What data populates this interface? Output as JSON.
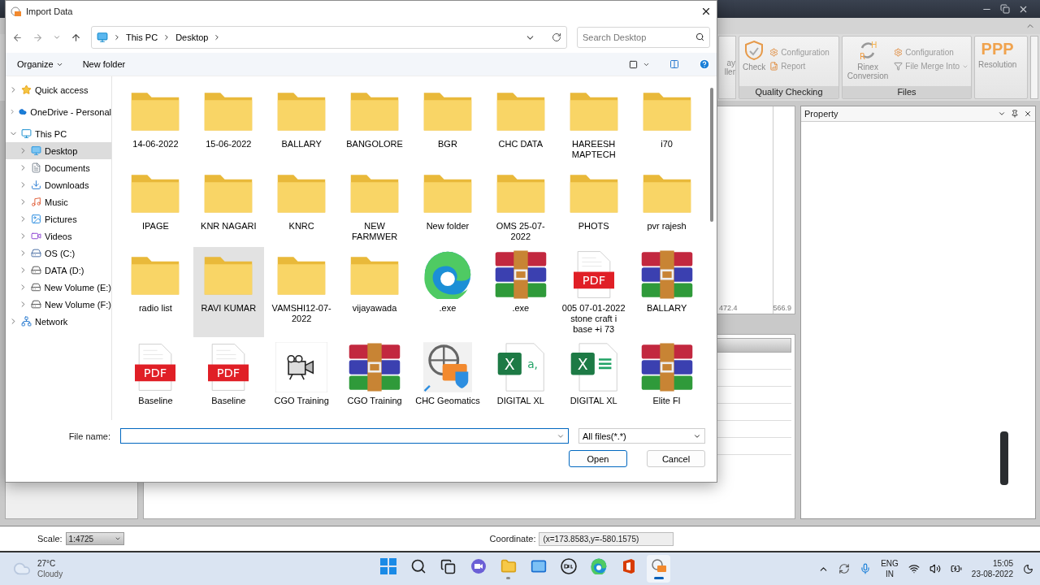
{
  "app": {
    "ribbon": {
      "partial_button": {
        "line_1": "ay",
        "line_2": "ller"
      },
      "groups": [
        {
          "label": "Quality Checking",
          "large": {
            "kind": "qc",
            "label": "Check"
          },
          "small": [
            {
              "kind": "config",
              "label": "Configuration",
              "dropdown": false
            },
            {
              "kind": "report",
              "label": "Report",
              "dropdown": false
            }
          ]
        },
        {
          "label": "Files",
          "large": {
            "kind": "rinex",
            "letters": [
              "R",
              "H"
            ],
            "label": "Rinex Conversion"
          },
          "small": [
            {
              "kind": "config",
              "label": "Configuration",
              "dropdown": false
            },
            {
              "kind": "merge",
              "label": "File Merge Into",
              "dropdown": true
            }
          ]
        },
        {
          "large": {
            "kind": "ppp",
            "glyph": "PPP",
            "label": "Resolution"
          }
        }
      ]
    },
    "plot": {
      "axis_labels": [
        "472.4",
        "566.9"
      ]
    },
    "property_panel": {
      "title": "Property"
    },
    "status_bar": {
      "scale_label": "Scale:",
      "scale_value": "1:4725",
      "coordinate_label": "Coordinate:",
      "coordinate_value": "(x=173.8583,y=-580.1575)"
    }
  },
  "dialog": {
    "title": "Import Data",
    "breadcrumb": [
      "This PC",
      "Desktop"
    ],
    "search_placeholder": "Search Desktop",
    "commands": [
      {
        "label": "Organize",
        "dropdown": true
      },
      {
        "label": "New folder",
        "dropdown": false
      }
    ],
    "sidebar": [
      {
        "kind": "star",
        "label": "Quick access",
        "expanded": false,
        "selected": false
      },
      {
        "kind": "cloud",
        "label": "OneDrive - Personal",
        "expanded": false,
        "selected": false
      },
      {
        "kind": "pc",
        "label": "This PC",
        "expanded": true,
        "selected": false,
        "children": [
          {
            "kind": "desktop",
            "label": "Desktop",
            "expanded": false,
            "selected": true
          },
          {
            "kind": "documents",
            "label": "Documents",
            "expanded": false,
            "selected": false
          },
          {
            "kind": "downloads",
            "label": "Downloads",
            "expanded": false,
            "selected": false
          },
          {
            "kind": "music",
            "label": "Music",
            "expanded": false,
            "selected": false
          },
          {
            "kind": "pictures",
            "label": "Pictures",
            "expanded": false,
            "selected": false
          },
          {
            "kind": "videos",
            "label": "Videos",
            "expanded": false,
            "selected": false
          },
          {
            "kind": "osdrive",
            "label": "OS (C:)",
            "expanded": false,
            "selected": false
          },
          {
            "kind": "drive",
            "label": "DATA (D:)",
            "expanded": false,
            "selected": false
          },
          {
            "kind": "drive",
            "label": "New Volume (E:)",
            "expanded": false,
            "selected": false
          },
          {
            "kind": "drive",
            "label": "New Volume (F:)",
            "expanded": false,
            "selected": false
          }
        ]
      },
      {
        "kind": "network",
        "label": "Network",
        "expanded": false,
        "selected": false
      }
    ],
    "files": [
      {
        "kind": "folder",
        "name": "14-06-2022",
        "selected": false
      },
      {
        "kind": "folder",
        "name": "15-06-2022",
        "selected": false
      },
      {
        "kind": "folder",
        "name": "BALLARY",
        "selected": false
      },
      {
        "kind": "folder",
        "name": "BANGOLORE",
        "selected": false
      },
      {
        "kind": "folder",
        "name": "BGR",
        "selected": false
      },
      {
        "kind": "folder",
        "name": "CHC DATA",
        "selected": false
      },
      {
        "kind": "folder",
        "name": "HAREESH MAPTECH",
        "selected": false
      },
      {
        "kind": "folder",
        "name": "i70",
        "selected": false
      },
      {
        "kind": "folder",
        "name": "IPAGE",
        "selected": false
      },
      {
        "kind": "folder",
        "name": "KNR NAGARI",
        "selected": false
      },
      {
        "kind": "folder",
        "name": "KNRC",
        "selected": false
      },
      {
        "kind": "folder",
        "name": "NEW FARMWER",
        "selected": false
      },
      {
        "kind": "folder",
        "name": "New folder",
        "selected": false
      },
      {
        "kind": "folder",
        "name": "OMS 25-07-2022",
        "selected": false
      },
      {
        "kind": "folder",
        "name": "PHOTS",
        "selected": false
      },
      {
        "kind": "folder",
        "name": "pvr rajesh",
        "selected": false
      },
      {
        "kind": "folder",
        "name": "radio list",
        "selected": false
      },
      {
        "kind": "folder",
        "name": "RAVI KUMAR",
        "selected": true
      },
      {
        "kind": "folder",
        "name": "VAMSHI12-07-2022",
        "selected": false
      },
      {
        "kind": "folder",
        "name": "vijayawada",
        "selected": false
      },
      {
        "kind": "browser",
        "name": ".exe",
        "selected": false
      },
      {
        "kind": "archive",
        "name": ".exe",
        "selected": false
      },
      {
        "kind": "pdf",
        "badge": "PDF",
        "name": "005 07-01-2022 stone craft i base +i 73",
        "selected": false
      },
      {
        "kind": "archive",
        "name": "BALLARY",
        "selected": false
      },
      {
        "kind": "pdf",
        "badge": "PDF",
        "name": "Baseline",
        "selected": false
      },
      {
        "kind": "pdf",
        "badge": "PDF",
        "name": "Baseline",
        "selected": false
      },
      {
        "kind": "camera",
        "name": "CGO Training",
        "selected": false
      },
      {
        "kind": "archive",
        "name": "CGO Training",
        "selected": false
      },
      {
        "kind": "globe",
        "name": "CHC Geomatics",
        "selected": false
      },
      {
        "kind": "csv",
        "badge": "X",
        "badge_2": "a,",
        "name": "DIGITAL XL",
        "selected": false
      },
      {
        "kind": "sheet",
        "badge": "X",
        "name": "DIGITAL XL",
        "selected": false
      },
      {
        "kind": "archive",
        "name": "Elite FI",
        "selected": false
      }
    ],
    "file_name": {
      "label": "File name:",
      "focused": true
    },
    "file_type": "All files(*.*)",
    "buttons": [
      {
        "label": "Open",
        "default": true
      },
      {
        "label": "Cancel",
        "default": false
      }
    ]
  },
  "taskbar": {
    "weather": {
      "temp": "27°C",
      "condition": "Cloudy"
    },
    "apps": [
      {
        "kind": "start",
        "running": false,
        "active": false
      },
      {
        "kind": "search",
        "running": false,
        "active": false
      },
      {
        "kind": "taskview",
        "running": false,
        "active": false
      },
      {
        "kind": "chat",
        "running": false,
        "active": false
      },
      {
        "kind": "explorer",
        "running": true,
        "active": false
      },
      {
        "kind": "mail",
        "running": false,
        "active": false
      },
      {
        "kind": "dell",
        "running": false,
        "active": false
      },
      {
        "kind": "browser",
        "running": false,
        "active": false
      },
      {
        "kind": "office",
        "running": false,
        "active": false
      },
      {
        "kind": "gnss",
        "running": true,
        "active": true
      }
    ],
    "tray": {
      "language": "ENG",
      "region": "IN",
      "time": "15:05",
      "date": "23-08-2022"
    }
  }
}
